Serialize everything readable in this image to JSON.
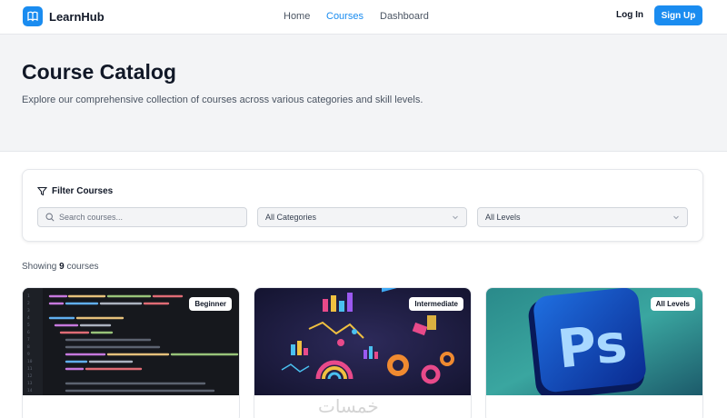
{
  "header": {
    "brand": "LearnHub",
    "nav": [
      {
        "label": "Home",
        "active": false
      },
      {
        "label": "Courses",
        "active": true
      },
      {
        "label": "Dashboard",
        "active": false
      }
    ],
    "login_label": "Log In",
    "signup_label": "Sign Up"
  },
  "hero": {
    "title": "Course Catalog",
    "description": "Explore our comprehensive collection of courses across various categories and skill levels."
  },
  "filters": {
    "title": "Filter Courses",
    "search_placeholder": "Search courses...",
    "category_value": "All Categories",
    "level_value": "All Levels"
  },
  "results": {
    "prefix": "Showing",
    "count": "9",
    "suffix": "courses"
  },
  "courses": [
    {
      "badge": "Beginner",
      "image": "code-editor-screenshot"
    },
    {
      "badge": "Intermediate",
      "image": "3d-data-charts"
    },
    {
      "badge": "All Levels",
      "image": "photoshop-logo"
    }
  ],
  "colors": {
    "accent": "#1a8cf0",
    "hero_bg": "#f3f4f6"
  },
  "watermark": "خمسات"
}
